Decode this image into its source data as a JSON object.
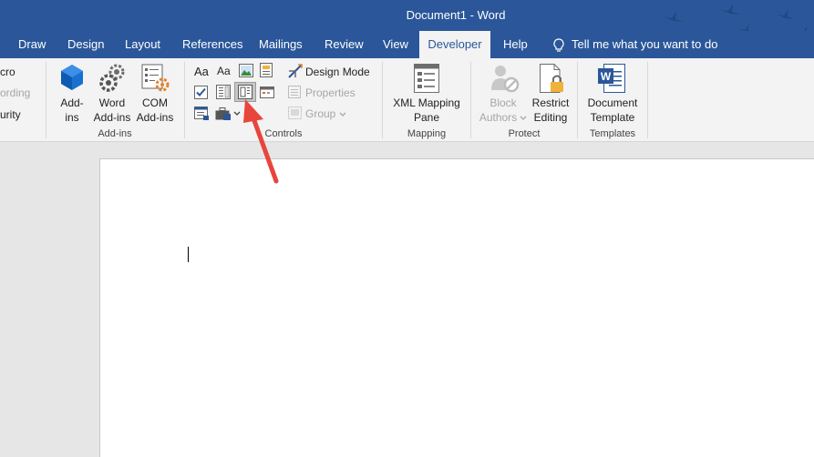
{
  "window": {
    "title": "Document1 - Word"
  },
  "tabs": [
    {
      "label": "Draw",
      "active": false
    },
    {
      "label": "Design",
      "active": false
    },
    {
      "label": "Layout",
      "active": false
    },
    {
      "label": "References",
      "active": false
    },
    {
      "label": "Mailings",
      "active": false
    },
    {
      "label": "Review",
      "active": false
    },
    {
      "label": "View",
      "active": false
    },
    {
      "label": "Developer",
      "active": true
    },
    {
      "label": "Help",
      "active": false
    }
  ],
  "tell_me": {
    "placeholder": "Tell me what you want to do",
    "icon": "lightbulb-icon"
  },
  "ribbon": {
    "code": {
      "items": [
        {
          "label": "cro",
          "enabled": true
        },
        {
          "label": "ording",
          "enabled": false
        },
        {
          "label": "urity",
          "enabled": true
        }
      ]
    },
    "addins": {
      "group_label": "Add-ins",
      "buttons": [
        {
          "line1": "Add-",
          "line2": "ins",
          "icon": "office-addins-icon"
        },
        {
          "line1": "Word",
          "line2": "Add-ins",
          "icon": "gear-addins-icon"
        },
        {
          "line1": "COM",
          "line2": "Add-ins",
          "icon": "com-addins-icon"
        }
      ]
    },
    "controls": {
      "group_label": "Controls",
      "icons": [
        "rich-text-content-control-icon",
        "plain-text-content-control-icon",
        "picture-content-control-icon",
        "building-block-gallery-control-icon",
        "checkbox-content-control-icon",
        "combo-box-content-control-icon",
        "dropdown-list-content-control-icon",
        "date-picker-content-control-icon",
        "repeating-section-content-control-icon",
        "legacy-tools-icon"
      ],
      "rich_text_glyph": "Aa",
      "plain_text_glyph": "Aa",
      "design_mode": {
        "label": "Design Mode",
        "enabled": true
      },
      "properties": {
        "label": "Properties",
        "enabled": false
      },
      "group": {
        "label": "Group",
        "enabled": false
      }
    },
    "mapping": {
      "group_label": "Mapping",
      "button": {
        "line1": "XML Mapping",
        "line2": "Pane",
        "icon": "xml-mapping-pane-icon"
      }
    },
    "protect": {
      "group_label": "Protect",
      "buttons": [
        {
          "line1": "Block",
          "line2": "Authors",
          "enabled": false,
          "icon": "block-authors-icon"
        },
        {
          "line1": "Restrict",
          "line2": "Editing",
          "enabled": true,
          "icon": "restrict-editing-icon"
        }
      ]
    },
    "templates": {
      "group_label": "Templates",
      "button": {
        "line1": "Document",
        "line2": "Template",
        "icon": "word-document-template-icon"
      }
    }
  },
  "colors": {
    "title_bar": "#2b579a",
    "ribbon": "#f3f3f3",
    "document_background": "#e6e6e6",
    "annotation_arrow": "#e8453c"
  }
}
